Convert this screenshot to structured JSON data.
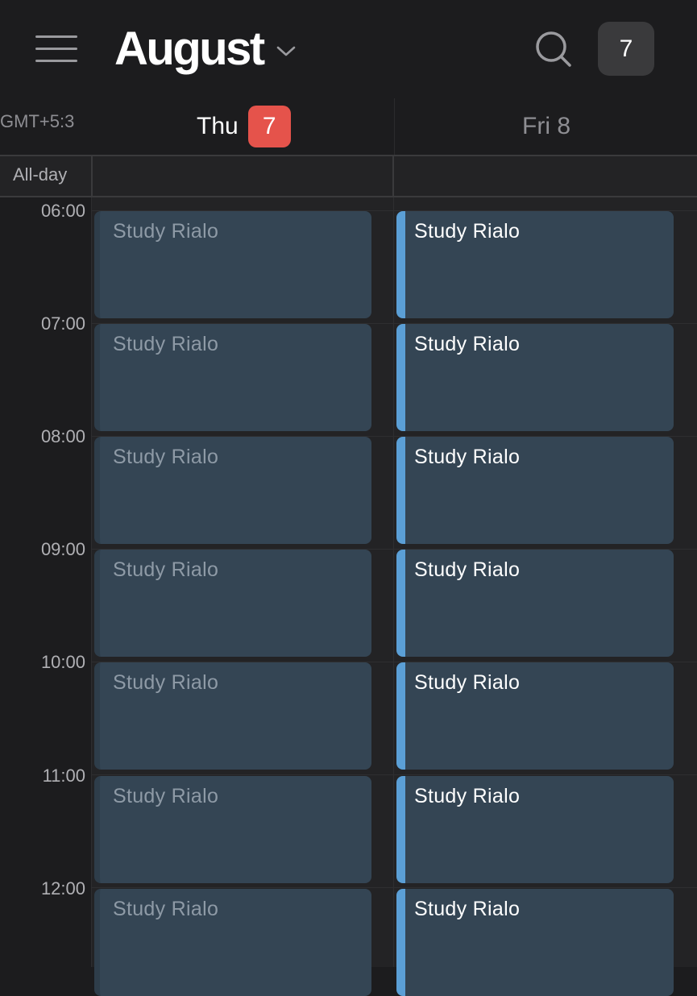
{
  "header": {
    "menu_icon": "hamburger-menu-icon",
    "month": "August",
    "dropdown_icon": "chevron-down-icon",
    "search_icon": "search-icon",
    "today_button": "7"
  },
  "day_header": {
    "timezone": "GMT+5:3",
    "days": [
      {
        "label": "Thu",
        "date": "7",
        "is_today": true
      },
      {
        "label": "Fri 8",
        "is_today": false
      }
    ]
  },
  "all_day": {
    "label": "All-day"
  },
  "hours": [
    "06:00",
    "07:00",
    "08:00",
    "09:00",
    "10:00",
    "11:00",
    "12:00"
  ],
  "events": {
    "thu": [
      "Study Rialo",
      "Study Rialo",
      "Study Rialo",
      "Study Rialo",
      "Study Rialo",
      "Study Rialo",
      "Study Rialo"
    ],
    "fri": [
      "Study Rialo",
      "Study Rialo",
      "Study Rialo",
      "Study Rialo",
      "Study Rialo",
      "Study Rialo",
      "Study Rialo"
    ]
  },
  "colors": {
    "background": "#1c1c1e",
    "today_badge": "#e5534b",
    "event_fill": "#344554",
    "event_accent": "#5b9fd6"
  }
}
